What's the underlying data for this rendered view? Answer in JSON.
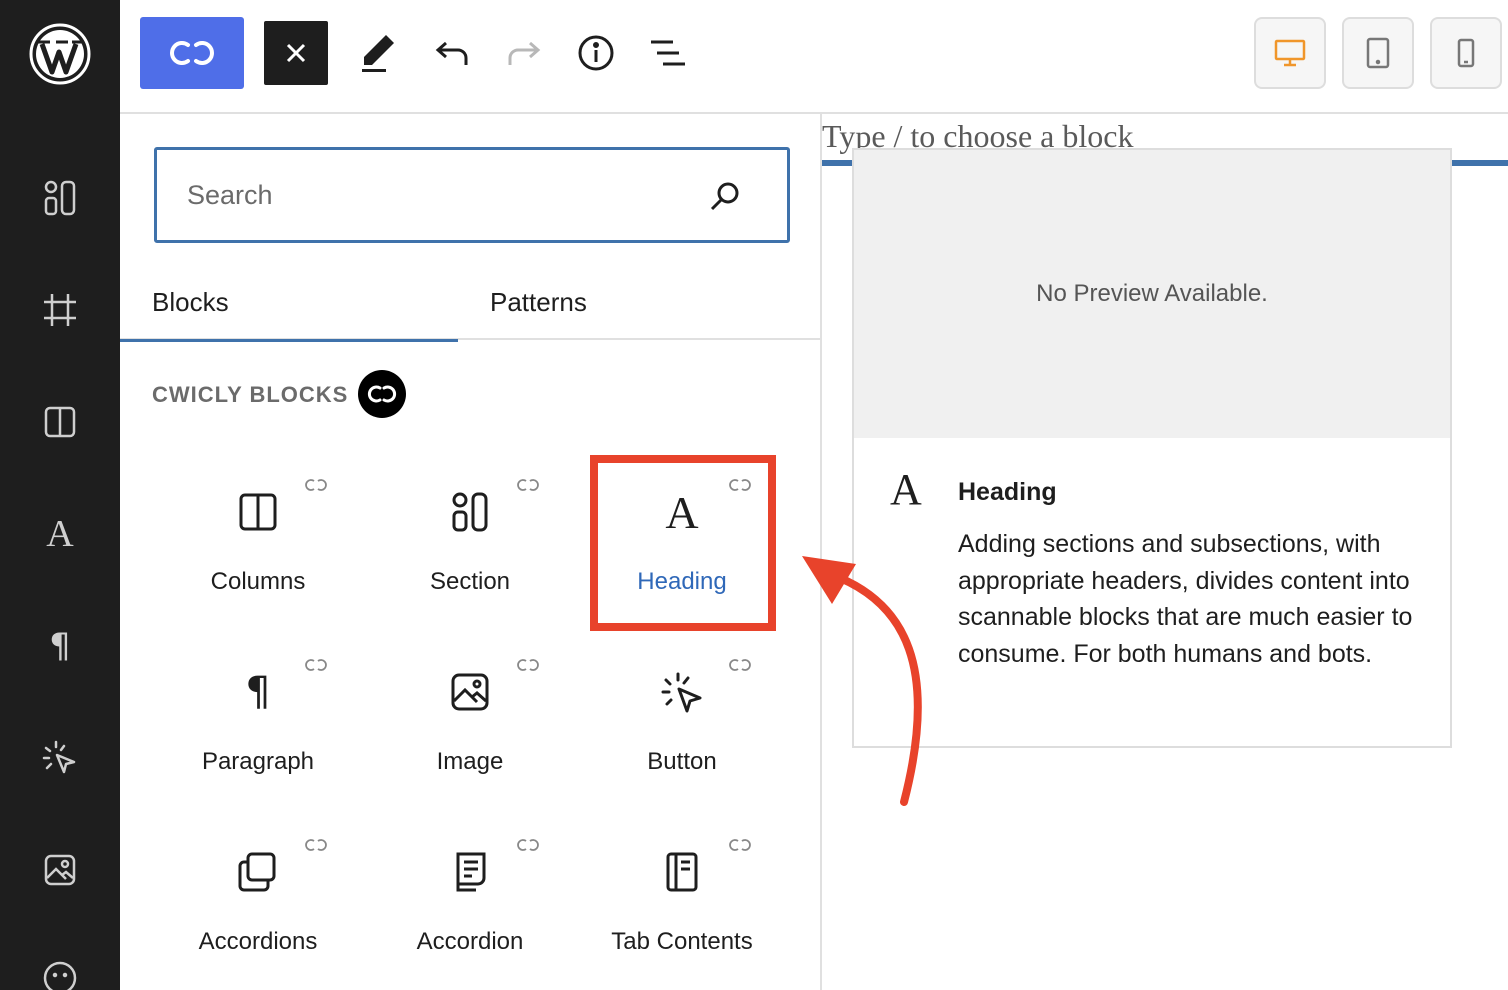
{
  "toolbar": {
    "cwicly_button_icon": "cwicly-logo-icon",
    "close_button_icon": "close-icon",
    "tools": [
      "pencil-icon",
      "undo-icon",
      "redo-icon",
      "info-icon",
      "list-view-icon"
    ],
    "devices": [
      "desktop-icon",
      "tablet-icon",
      "mobile-icon"
    ],
    "active_device_color": "#f0962b"
  },
  "sidebar": {
    "icons": [
      "wordpress-logo",
      "section-icon",
      "frame-icon",
      "columns-icon",
      "heading-icon",
      "paragraph-icon",
      "button-icon",
      "image-icon",
      "smiley-icon"
    ]
  },
  "inserter": {
    "search_placeholder": "Search",
    "tabs": [
      {
        "label": "Blocks",
        "active": true
      },
      {
        "label": "Patterns",
        "active": false
      }
    ],
    "category": "CWICLY BLOCKS",
    "blocks": [
      {
        "label": "Columns",
        "icon": "columns-icon"
      },
      {
        "label": "Section",
        "icon": "section-icon"
      },
      {
        "label": "Heading",
        "icon": "heading-icon",
        "highlighted": true
      },
      {
        "label": "Paragraph",
        "icon": "paragraph-icon"
      },
      {
        "label": "Image",
        "icon": "image-icon"
      },
      {
        "label": "Button",
        "icon": "button-icon"
      },
      {
        "label": "Accordions",
        "icon": "accordions-icon"
      },
      {
        "label": "Accordion",
        "icon": "accordion-icon"
      },
      {
        "label": "Tab Contents",
        "icon": "tab-contents-icon"
      }
    ]
  },
  "canvas": {
    "placeholder": "Type / to choose a block"
  },
  "preview": {
    "no_preview": "No Preview Available.",
    "title": "Heading",
    "description": "Adding sections and subsections, with appropriate headers, divides content into scannable blocks that are much easier to consume. For both humans and bots."
  },
  "colors": {
    "accent": "#3f72ab",
    "cwicly": "#4f6ee8",
    "annotation": "#e8432b",
    "sidebar_bg": "#1e1e1e"
  }
}
